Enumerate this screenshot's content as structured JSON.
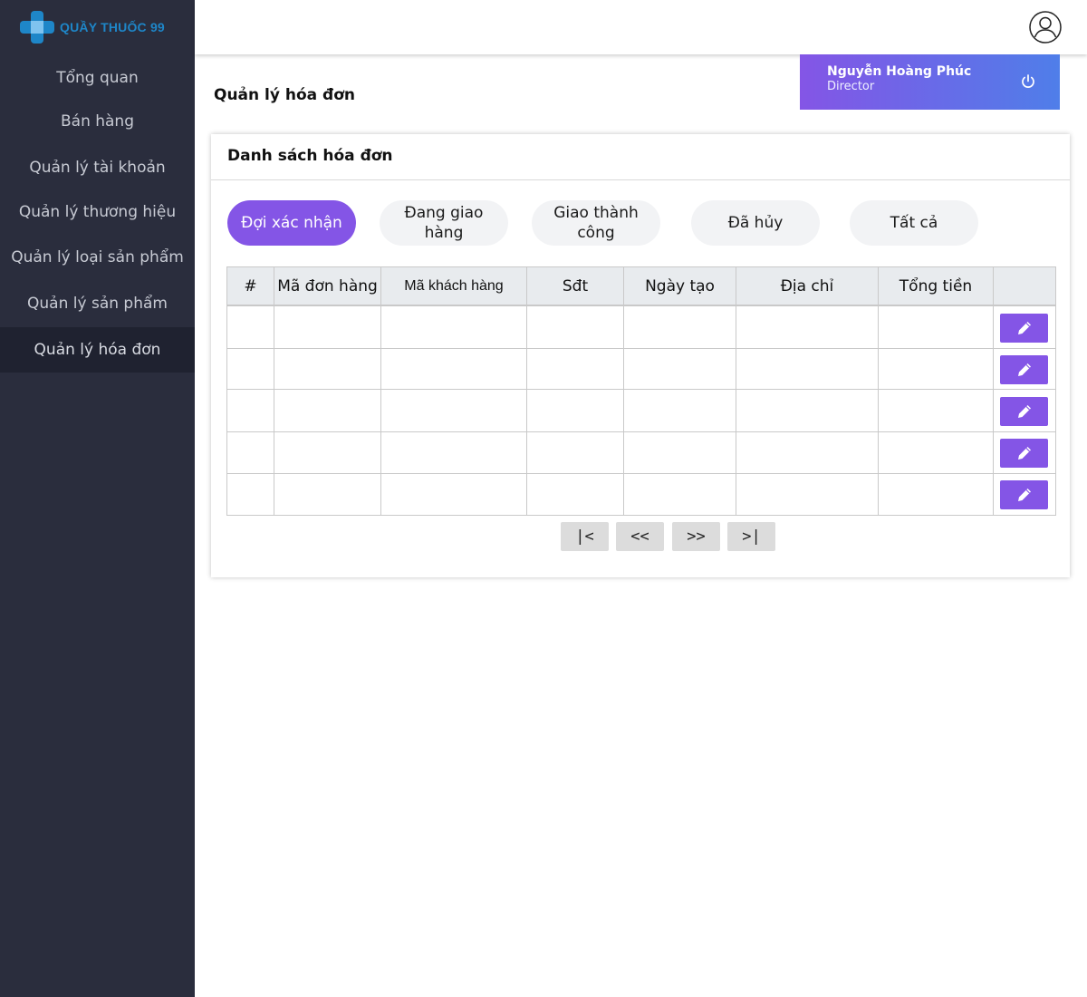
{
  "brand": {
    "name": "QUẦY THUỐC 99"
  },
  "sidebar": {
    "items": [
      {
        "label": "Tổng quan"
      },
      {
        "label": "Bán hàng"
      },
      {
        "label": "Quản lý tài khoản"
      },
      {
        "label": "Quản lý thương hiệu"
      },
      {
        "label": "Quản lý loại sản phẩm"
      },
      {
        "label": "Quản lý sản phẩm"
      },
      {
        "label": "Quản lý hóa đơn",
        "active": true
      }
    ]
  },
  "user": {
    "name": "Nguyễn Hoàng Phúc",
    "role": "Director"
  },
  "page": {
    "title": "Quản lý hóa đơn"
  },
  "card": {
    "title": "Danh sách hóa đơn"
  },
  "status_tabs": [
    {
      "label": "Đợi xác nhận",
      "active": true
    },
    {
      "label": "Đang giao hàng"
    },
    {
      "label": "Giao thành công"
    },
    {
      "label": "Đã hủy"
    },
    {
      "label": "Tất cả"
    }
  ],
  "table": {
    "columns": [
      "#",
      "Mã đơn hàng",
      "Mã khách hàng",
      "Sđt",
      "Ngày tạo",
      "Địa chỉ",
      "Tổng tiền",
      ""
    ],
    "rows": [
      [
        "",
        "",
        "",
        "",
        "",
        "",
        ""
      ],
      [
        "",
        "",
        "",
        "",
        "",
        "",
        ""
      ],
      [
        "",
        "",
        "",
        "",
        "",
        "",
        ""
      ],
      [
        "",
        "",
        "",
        "",
        "",
        "",
        ""
      ],
      [
        "",
        "",
        "",
        "",
        "",
        "",
        ""
      ]
    ]
  },
  "pagination": {
    "first": "|<",
    "prev": "<<",
    "next": ">>",
    "last": ">|"
  },
  "colors": {
    "accent": "#8455e6",
    "sidebar": "#2a2d3d",
    "brand": "#1e86c8"
  }
}
